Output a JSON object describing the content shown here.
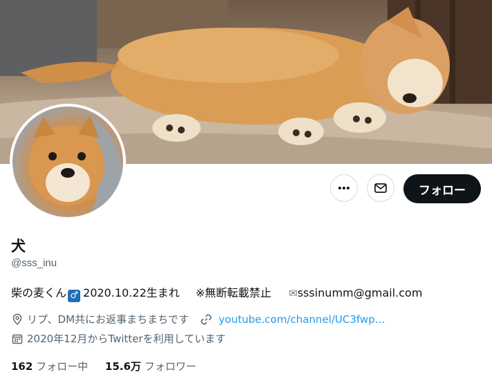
{
  "profile": {
    "display_name": "犬",
    "handle": "@sss_inu",
    "bio_prefix": "柴の麦くん",
    "bio_male_symbol": "♂",
    "bio_birth": "2020.10.22生まれ",
    "bio_notice": "※無断転載禁止",
    "bio_email": "sssinumm@gmail.com",
    "location": "リプ、DM共にお返事まちまちです",
    "website": "youtube.com/channel/UC3fwp...",
    "joined": "2020年12月からTwitterを利用しています"
  },
  "actions": {
    "follow_label": "フォロー",
    "more_icon": "more-icon",
    "message_icon": "envelope-icon"
  },
  "stats": {
    "following_count": "162",
    "following_label": "フォロー中",
    "followers_count": "15.6万",
    "followers_label": "フォロワー"
  },
  "colors": {
    "text": "#0f1419",
    "secondary": "#536471",
    "link": "#1d9bf0",
    "follow_button_bg": "#0f1419"
  }
}
